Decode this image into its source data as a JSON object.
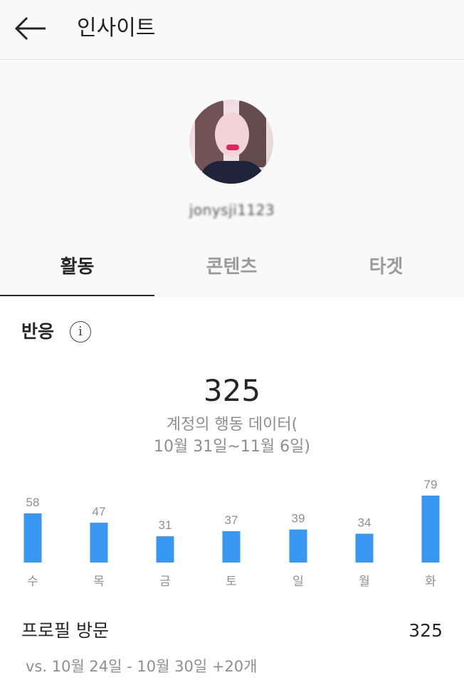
{
  "header": {
    "title": "인사이트",
    "back_icon": "arrow-left-icon"
  },
  "profile": {
    "username": "jonysji1123"
  },
  "tabs": [
    {
      "label": "활동",
      "active": true
    },
    {
      "label": "콘텐츠",
      "active": false
    },
    {
      "label": "타겟",
      "active": false
    }
  ],
  "section": {
    "title": "반응",
    "info_icon": "info-icon"
  },
  "summary": {
    "total": "325",
    "description_line1": "계정의 행동 데이터(",
    "description_line2": "10월 31일~11월 6일)"
  },
  "chart_data": {
    "type": "bar",
    "categories": [
      "수",
      "목",
      "금",
      "토",
      "일",
      "월",
      "화"
    ],
    "values": [
      58,
      47,
      31,
      37,
      39,
      34,
      79
    ],
    "color": "#3897f0"
  },
  "profile_visits": {
    "label": "프로필 방문",
    "value": "325",
    "comparison": "vs. 10월 24일 - 10월 30일 +20개"
  }
}
